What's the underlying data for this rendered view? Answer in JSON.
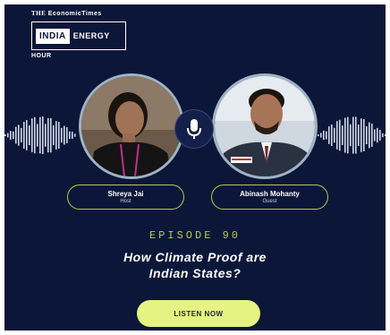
{
  "brand": {
    "prefix": "THE",
    "publication": "EconomicTimes",
    "india": "INDIA",
    "energy": "ENERGY",
    "hour": "HOUR"
  },
  "speakers": [
    {
      "name": "Shreya Jai",
      "role": "Host"
    },
    {
      "name": "Abinash Mohanty",
      "role": "Guest"
    }
  ],
  "episode": "EPISODE 90",
  "title_line1": "How Climate Proof are",
  "title_line2": "Indian States?",
  "cta": "LISTEN NOW",
  "colors": {
    "background": "#0c1638",
    "accent_green": "#b4cf45",
    "button_fill": "#e4f382",
    "wave": "#cfd8e6"
  },
  "icons": {
    "center": "microphone-icon"
  }
}
